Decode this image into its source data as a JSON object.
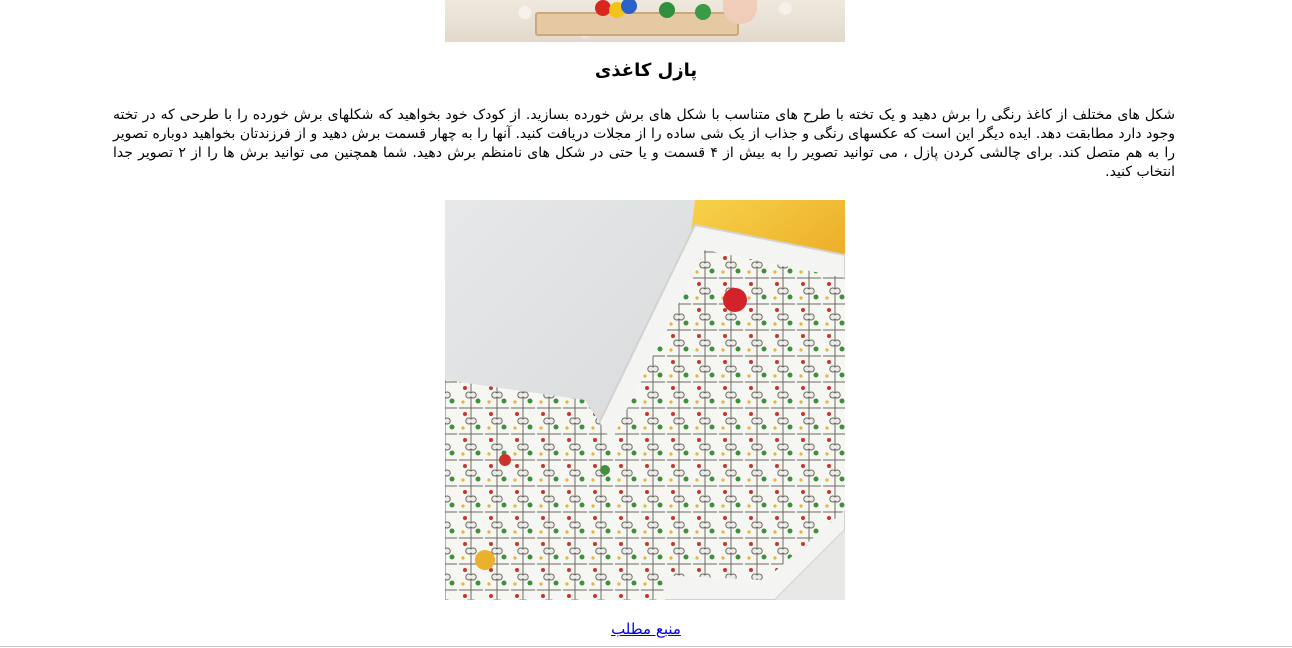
{
  "article": {
    "title": "پازل کاغذی",
    "body": "شکل های مختلف از کاغذ رنگی را برش دهید و یک تخته با طرح های متناسب با شکل های برش خورده بسازید. از کودک خود بخواهید که شکلهای برش خورده را با طرحی که در تخته وجود دارد مطابقت دهد. ایده دیگر این است که عکسهای رنگی و جذاب از یک شی ساده را از مجلات دریافت کنید. آنها را به چهار قسمت برش دهید و از فرزندتان بخواهید دوباره تصویر را به هم متصل کند. برای چالشی کردن پازل ، می توانید تصویر را به بیش از ۴ قسمت و یا حتی در شکل های نامنظم برش دهید. شما همچنین می توانید برش ها را از ۲ تصویر جدا انتخاب کنید.",
    "source_link": "منبع مطلب"
  }
}
